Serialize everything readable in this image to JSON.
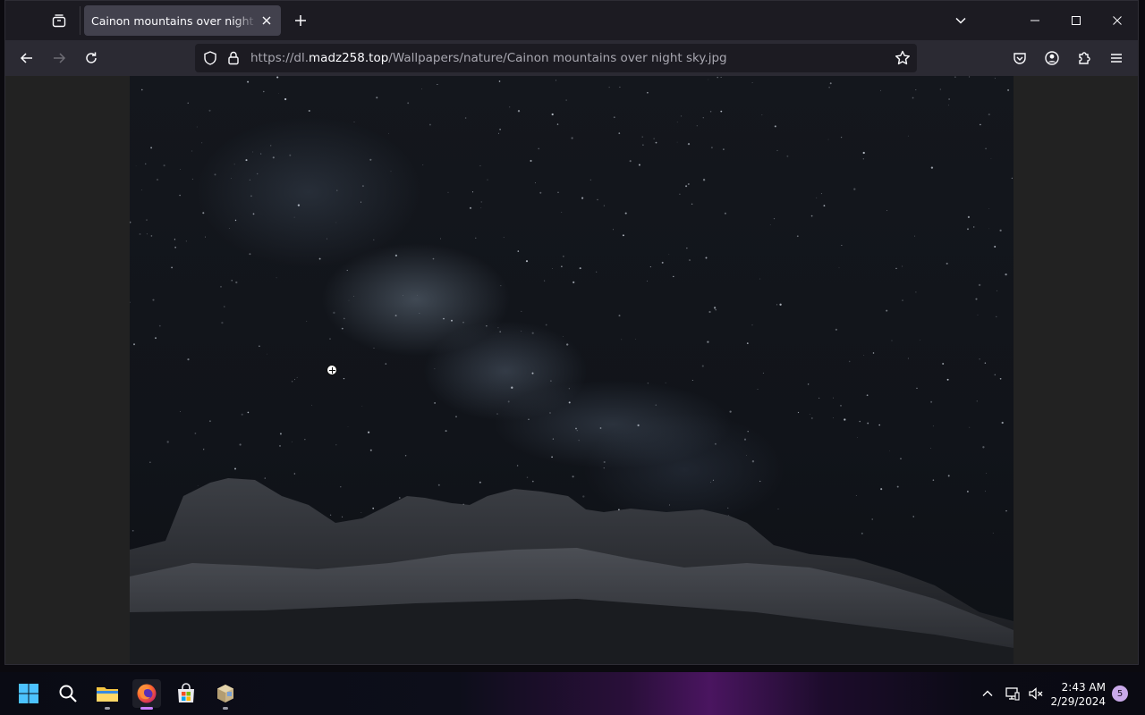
{
  "browser": {
    "tab": {
      "title": "Cainon mountains over night sky.jpg"
    },
    "url": {
      "prefix": "https://dl.",
      "host": "madz258.top",
      "path": "/Wallpapers/nature/Cainon mountains over night sky.jpg"
    },
    "icons": {
      "tabs_list": "tab-overview-icon",
      "close_tab": "close-icon",
      "new_tab": "plus-icon",
      "list_all_tabs": "chevron-down-icon",
      "back": "arrow-left-icon",
      "forward": "arrow-right-icon",
      "reload": "reload-icon",
      "shield": "shield-icon",
      "lock": "lock-icon",
      "bookmark": "star-icon",
      "pocket": "pocket-icon",
      "account": "account-icon",
      "extensions": "puzzle-icon",
      "menu": "hamburger-icon"
    }
  },
  "content": {
    "image_description": "night sky with milky way over rocky mountains"
  },
  "taskbar": {
    "apps": [
      "start",
      "search",
      "file-explorer",
      "firefox",
      "microsoft-store",
      "package"
    ],
    "clock": {
      "time": "2:43 AM",
      "date": "2/29/2024"
    },
    "notification_count": "5"
  },
  "colors": {
    "accent": "#c77dff",
    "toolbar": "#2b2a33",
    "tabstrip": "#1c1b22"
  }
}
